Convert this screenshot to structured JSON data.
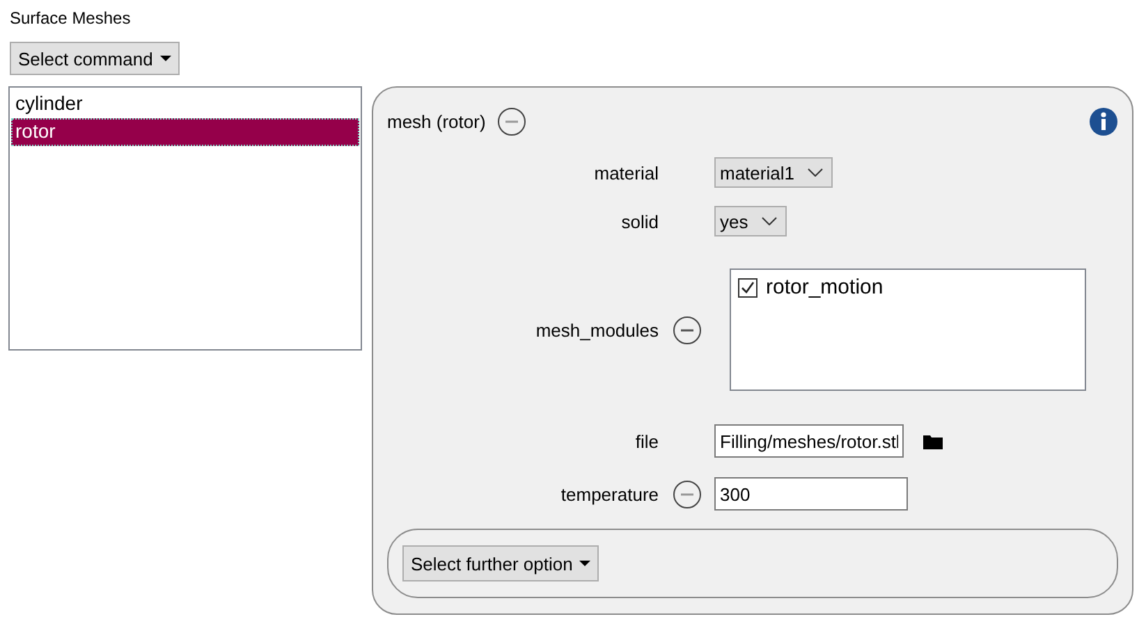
{
  "title": "Surface Meshes",
  "command_menu": {
    "label": "Select command"
  },
  "meshes": [
    {
      "label": "cylinder",
      "selected": false
    },
    {
      "label": "rotor",
      "selected": true
    }
  ],
  "panel": {
    "title": "mesh (rotor)",
    "fields": [
      {
        "kind": "select",
        "label": "material",
        "removable": false,
        "value": "material1"
      },
      {
        "kind": "select",
        "label": "solid",
        "removable": false,
        "value": "yes"
      },
      {
        "kind": "checklist",
        "label": "mesh_modules",
        "removable": true,
        "items": [
          {
            "label": "rotor_motion",
            "checked": true
          }
        ]
      },
      {
        "kind": "file",
        "label": "file",
        "removable": false,
        "value": "Filling/meshes/rotor.stl"
      },
      {
        "kind": "text",
        "label": "temperature",
        "removable": true,
        "value": "300"
      }
    ],
    "further_menu": {
      "label": "Select further option"
    }
  }
}
